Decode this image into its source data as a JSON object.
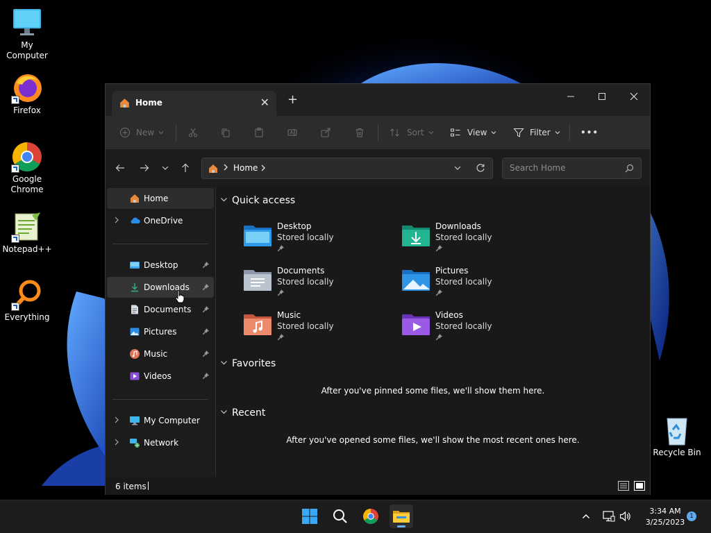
{
  "desktop": {
    "icons": [
      {
        "label": "My Computer"
      },
      {
        "label": "Firefox"
      },
      {
        "label": "Google Chrome"
      },
      {
        "label": "Notepad++"
      },
      {
        "label": "Everything"
      },
      {
        "label": "Recycle Bin"
      }
    ]
  },
  "window": {
    "tab_title": "Home",
    "tab_close": "✕",
    "new_tab": "+",
    "toolbar": {
      "new_label": "New",
      "sort_label": "Sort",
      "view_label": "View",
      "filter_label": "Filter",
      "more_label": "•••"
    },
    "address": {
      "crumb": "Home",
      "search_placeholder": "Search Home"
    },
    "nav": {
      "items": [
        {
          "label": "Home"
        },
        {
          "label": "OneDrive"
        },
        {
          "label": "Desktop"
        },
        {
          "label": "Downloads"
        },
        {
          "label": "Documents"
        },
        {
          "label": "Pictures"
        },
        {
          "label": "Music"
        },
        {
          "label": "Videos"
        },
        {
          "label": "My Computer"
        },
        {
          "label": "Network"
        }
      ]
    },
    "content": {
      "quick_access_title": "Quick access",
      "quick_access": [
        {
          "name": "Desktop",
          "sub": "Stored locally"
        },
        {
          "name": "Downloads",
          "sub": "Stored locally"
        },
        {
          "name": "Documents",
          "sub": "Stored locally"
        },
        {
          "name": "Pictures",
          "sub": "Stored locally"
        },
        {
          "name": "Music",
          "sub": "Stored locally"
        },
        {
          "name": "Videos",
          "sub": "Stored locally"
        }
      ],
      "favorites_title": "Favorites",
      "favorites_empty": "After you've pinned some files, we'll show them here.",
      "recent_title": "Recent",
      "recent_empty": "After you've opened some files, we'll show the most recent ones here."
    },
    "status": {
      "item_count": "6 items"
    }
  },
  "taskbar": {
    "time": "3:34 AM",
    "date": "3/25/2023",
    "notifications": "1"
  },
  "colors": {
    "accent": "#4cc2ff",
    "folder_blue": "#2f8fe0",
    "folder_teal": "#1fa58e",
    "window_bg": "#191919"
  }
}
